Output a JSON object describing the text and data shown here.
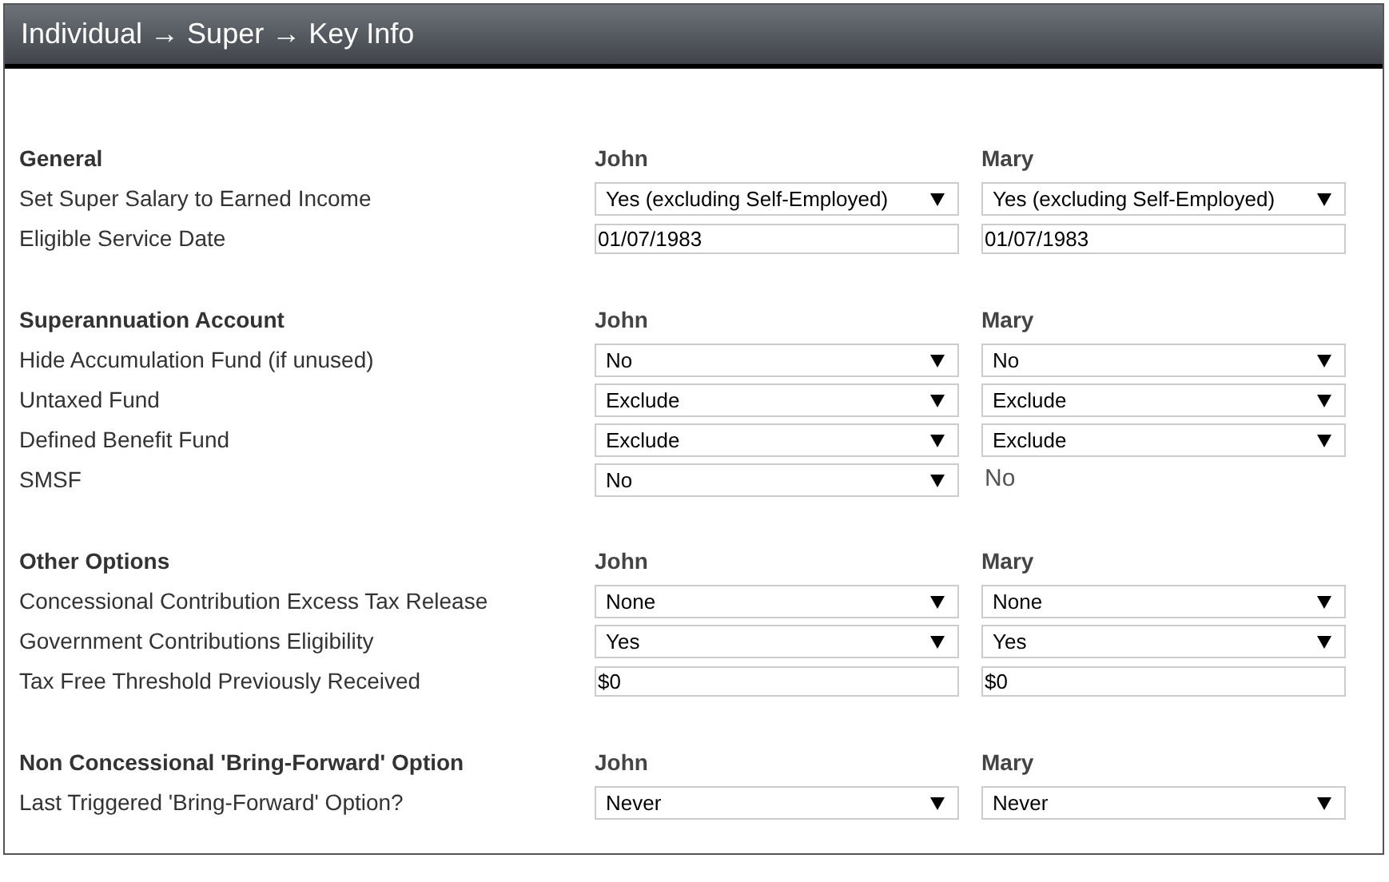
{
  "title": "Individual → Super → Key Info",
  "sections": [
    {
      "heading": "General",
      "columns": [
        "John",
        "Mary"
      ],
      "rows": [
        {
          "label": "Set Super Salary to Earned Income",
          "cells": [
            {
              "kind": "select",
              "value": "Yes (excluding Self-Employed)"
            },
            {
              "kind": "select",
              "value": "Yes (excluding Self-Employed)"
            }
          ]
        },
        {
          "label": "Eligible Service Date",
          "cells": [
            {
              "kind": "input",
              "value": "01/07/1983"
            },
            {
              "kind": "input",
              "value": "01/07/1983"
            }
          ]
        }
      ]
    },
    {
      "heading": "Superannuation Account",
      "columns": [
        "John",
        "Mary"
      ],
      "rows": [
        {
          "label": "Hide Accumulation Fund (if unused)",
          "cells": [
            {
              "kind": "select",
              "value": "No"
            },
            {
              "kind": "select",
              "value": "No"
            }
          ]
        },
        {
          "label": "Untaxed Fund",
          "cells": [
            {
              "kind": "select",
              "value": "Exclude"
            },
            {
              "kind": "select",
              "value": "Exclude"
            }
          ]
        },
        {
          "label": "Defined Benefit Fund",
          "cells": [
            {
              "kind": "select",
              "value": "Exclude"
            },
            {
              "kind": "select",
              "value": "Exclude"
            }
          ]
        },
        {
          "label": "SMSF",
          "cells": [
            {
              "kind": "select",
              "value": "No"
            },
            {
              "kind": "text",
              "value": "No"
            }
          ]
        }
      ]
    },
    {
      "heading": "Other Options",
      "columns": [
        "John",
        "Mary"
      ],
      "rows": [
        {
          "label": "Concessional Contribution Excess Tax Release",
          "cells": [
            {
              "kind": "select",
              "value": "None"
            },
            {
              "kind": "select",
              "value": "None"
            }
          ]
        },
        {
          "label": "Government Contributions Eligibility",
          "cells": [
            {
              "kind": "select",
              "value": "Yes"
            },
            {
              "kind": "select",
              "value": "Yes"
            }
          ]
        },
        {
          "label": "Tax Free Threshold Previously Received",
          "cells": [
            {
              "kind": "input",
              "value": "$0"
            },
            {
              "kind": "input",
              "value": "$0"
            }
          ]
        }
      ]
    },
    {
      "heading": "Non Concessional 'Bring-Forward' Option",
      "columns": [
        "John",
        "Mary"
      ],
      "rows": [
        {
          "label": "Last Triggered 'Bring-Forward' Option?",
          "cells": [
            {
              "kind": "select",
              "value": "Never"
            },
            {
              "kind": "select",
              "value": "Never"
            }
          ]
        }
      ]
    }
  ]
}
